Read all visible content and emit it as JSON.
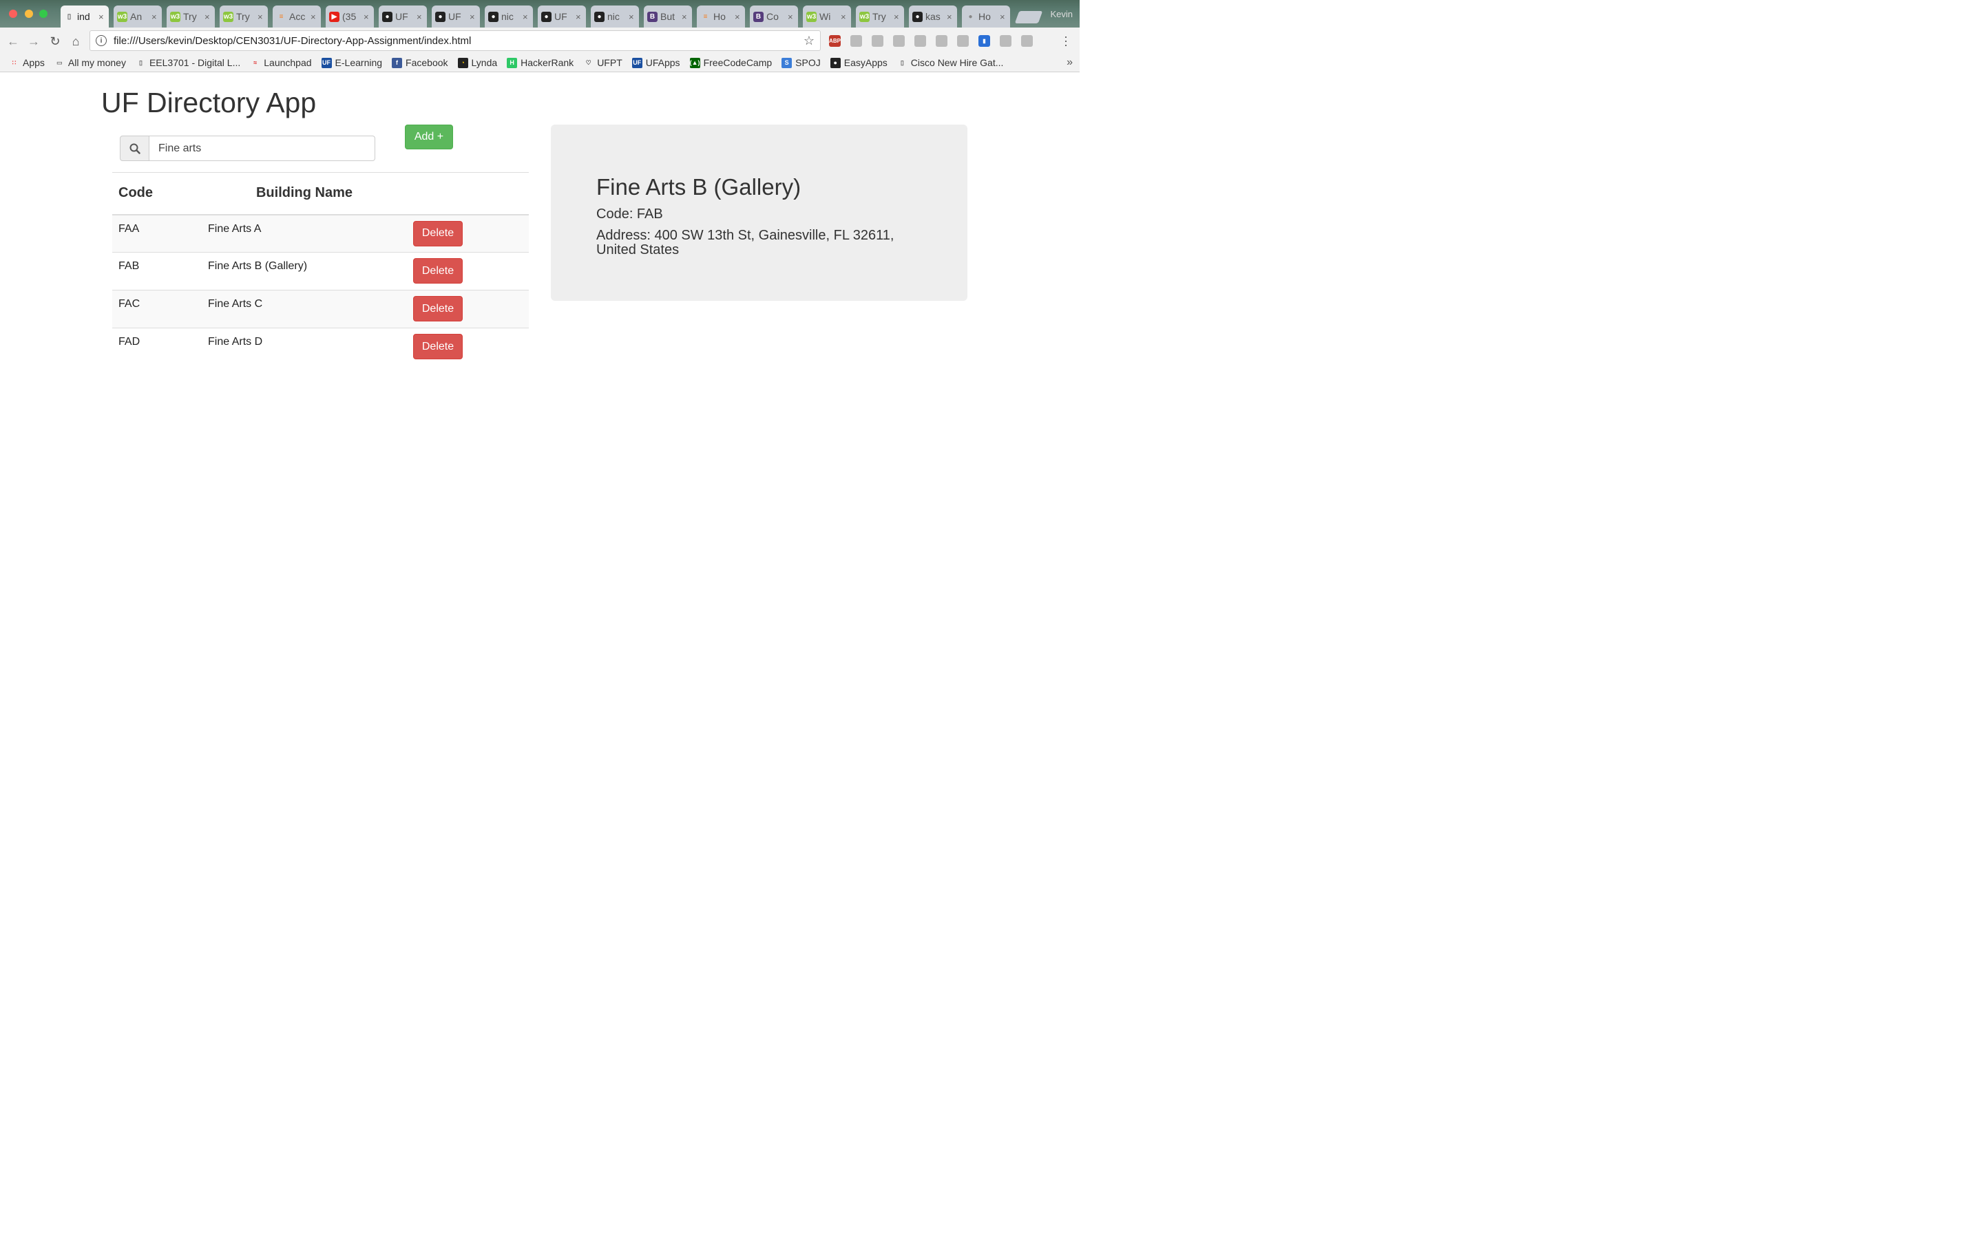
{
  "browser": {
    "tabs": [
      {
        "title": "ind",
        "icon": "page-icon",
        "active": true
      },
      {
        "title": "An",
        "icon": "w3schools-icon"
      },
      {
        "title": "Try",
        "icon": "w3schools-icon"
      },
      {
        "title": "Try",
        "icon": "w3schools-icon"
      },
      {
        "title": "Acc",
        "icon": "stackoverflow-icon"
      },
      {
        "title": "(35",
        "icon": "youtube-icon"
      },
      {
        "title": "UF",
        "icon": "github-icon"
      },
      {
        "title": "UF",
        "icon": "github-icon"
      },
      {
        "title": "nic",
        "icon": "github-icon"
      },
      {
        "title": "UF",
        "icon": "github-icon"
      },
      {
        "title": "nic",
        "icon": "github-icon"
      },
      {
        "title": "But",
        "icon": "bootstrap-icon"
      },
      {
        "title": "Ho",
        "icon": "stackoverflow-icon"
      },
      {
        "title": "Co",
        "icon": "bootstrap-icon"
      },
      {
        "title": "Wi",
        "icon": "w3schools-icon"
      },
      {
        "title": "Try",
        "icon": "w3schools-icon"
      },
      {
        "title": "kas",
        "icon": "github-icon"
      },
      {
        "title": "Ho",
        "icon": "apple-icon"
      }
    ],
    "profile_name": "Kevin",
    "url": "file:///Users/kevin/Desktop/CEN3031/UF-Directory-App-Assignment/index.html",
    "bookmarks": [
      {
        "label": "Apps",
        "icon": "apps-grid-icon"
      },
      {
        "label": "All my money",
        "icon": "folder-icon"
      },
      {
        "label": "EEL3701 - Digital L...",
        "icon": "page-icon"
      },
      {
        "label": "Launchpad",
        "icon": "launchpad-icon"
      },
      {
        "label": "E-Learning",
        "icon": "uf-icon"
      },
      {
        "label": "Facebook",
        "icon": "facebook-icon"
      },
      {
        "label": "Lynda",
        "icon": "lynda-icon"
      },
      {
        "label": "HackerRank",
        "icon": "hackerrank-icon"
      },
      {
        "label": "UFPT",
        "icon": "ufpt-icon"
      },
      {
        "label": "UFApps",
        "icon": "uf-icon"
      },
      {
        "label": "FreeCodeCamp",
        "icon": "freecodecamp-icon"
      },
      {
        "label": "SPOJ",
        "icon": "spoj-icon"
      },
      {
        "label": "EasyApps",
        "icon": "github-icon"
      },
      {
        "label": "Cisco New Hire Gat...",
        "icon": "page-icon"
      }
    ],
    "extensions": [
      "adblock-icon",
      "extension-icon",
      "extension-icon",
      "extension-icon",
      "extension-icon",
      "extension-icon",
      "extension-icon",
      "bookmark-icon",
      "extension-icon",
      "extension-icon"
    ]
  },
  "app": {
    "title": "UF Directory App",
    "search": {
      "value": "Fine arts",
      "placeholder": ""
    },
    "add_label": "Add +",
    "table": {
      "headers": {
        "code": "Code",
        "name": "Building Name"
      },
      "rows": [
        {
          "code": "FAA",
          "name": "Fine Arts A",
          "action": "Delete"
        },
        {
          "code": "FAB",
          "name": "Fine Arts B (Gallery)",
          "action": "Delete"
        },
        {
          "code": "FAC",
          "name": "Fine Arts C",
          "action": "Delete"
        },
        {
          "code": "FAD",
          "name": "Fine Arts D",
          "action": "Delete"
        }
      ]
    },
    "details": {
      "name": "Fine Arts B (Gallery)",
      "code_line": "Code: FAB",
      "address_line": "Address: 400 SW 13th St, Gainesville, FL 32611, United States"
    }
  },
  "colors": {
    "add": "#5cb85c",
    "delete": "#d9534f",
    "panel": "#eeeeee"
  }
}
